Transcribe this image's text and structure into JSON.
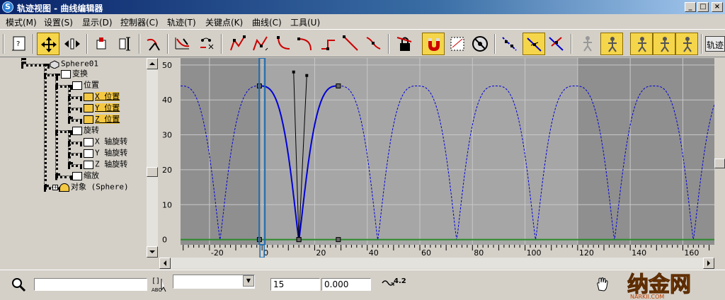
{
  "window": {
    "title": "轨迹视图 - 曲线编辑器",
    "app_icon": "S",
    "controls": [
      "_",
      "□",
      "×"
    ]
  },
  "menu": [
    {
      "label": "模式(M)"
    },
    {
      "label": "设置(S)"
    },
    {
      "label": "显示(D)"
    },
    {
      "label": "控制器(C)"
    },
    {
      "label": "轨迹(T)"
    },
    {
      "label": "关键点(K)"
    },
    {
      "label": "曲线(C)"
    },
    {
      "label": "工具(U)"
    }
  ],
  "toolbar": {
    "label_right": "轨迹",
    "buttons": [
      "filters-icon",
      "move-keys-icon",
      "slide-keys-icon",
      "insert-keys-icon",
      "scale-keys-icon",
      "draw-curves-icon",
      "add-keys-icon",
      "reduce-keys-icon",
      "tangent-auto-icon",
      "tangent-custom-icon",
      "tangent-fast-icon",
      "tangent-slow-icon",
      "tangent-step-icon",
      "tangent-linear-icon",
      "tangent-smooth-icon",
      "lock-selection-icon",
      "snap-frames-icon",
      "parameter-curve-icon",
      "disable-icon",
      "show-keys-icon",
      "show-tangents-icon",
      "lock-tangents-icon",
      "ghost-icon",
      "biped-x-icon",
      "biped-y-icon",
      "biped-z-icon"
    ],
    "active_color": "#f5d54a"
  },
  "tree": {
    "items": [
      {
        "label": "Sphere01",
        "icon": "sphere-object-icon"
      },
      {
        "label": "变换",
        "icon": "transform-icon"
      },
      {
        "label": "位置",
        "icon": "position-icon"
      },
      {
        "label": "X 位置",
        "icon": "curve-track-icon",
        "selected": true
      },
      {
        "label": "Y 位置",
        "icon": "curve-track-icon",
        "selected": true
      },
      {
        "label": "Z 位置",
        "icon": "curve-track-icon",
        "selected": true
      },
      {
        "label": "旋转",
        "icon": "rotation-icon"
      },
      {
        "label": "X 轴旋转",
        "icon": "curve-track-icon"
      },
      {
        "label": "Y 轴旋转",
        "icon": "curve-track-icon"
      },
      {
        "label": "Z 轴旋转",
        "icon": "curve-track-icon"
      },
      {
        "label": "缩放",
        "icon": "scale-icon"
      },
      {
        "label": "对象 (Sphere)",
        "icon": "object-modifier-icon"
      }
    ]
  },
  "graph": {
    "y_ticks": [
      0,
      10,
      20,
      30,
      40,
      50
    ],
    "x_ticks": [
      -20,
      0,
      20,
      40,
      60,
      80,
      100,
      120,
      140,
      160
    ],
    "x_range": [
      -31,
      172
    ],
    "y_range": [
      -1.5,
      52
    ],
    "active_range": [
      -1,
      120
    ],
    "current_frame": 0,
    "colors": {
      "background_active": "#a6a6a6",
      "background_inactive": "#8f8f8f",
      "curve": "#0000d8",
      "flat_curve": "#2a8a2a",
      "time_slider": "#1c6bb0",
      "grid": "#c8c8c8"
    },
    "curve_keys": [
      {
        "x": -1,
        "y": 44
      },
      {
        "x": 14,
        "y": 0
      },
      {
        "x": 29,
        "y": 44
      }
    ],
    "tangent_handles": [
      {
        "x": 12,
        "y": 48
      },
      {
        "x": 17,
        "y": 47
      }
    ],
    "loop_period": 30,
    "loop_range": [
      -31,
      172
    ]
  },
  "status": {
    "frame_value": "15",
    "value_field": "0.000",
    "zoom_value": "4.2",
    "icons": [
      "zoom-region-icon",
      "text-selection-icon",
      "pan-icon",
      "frame-zoom-icon"
    ]
  },
  "watermark": {
    "text": "纳金网",
    "subtext": "NARKII.COM"
  }
}
